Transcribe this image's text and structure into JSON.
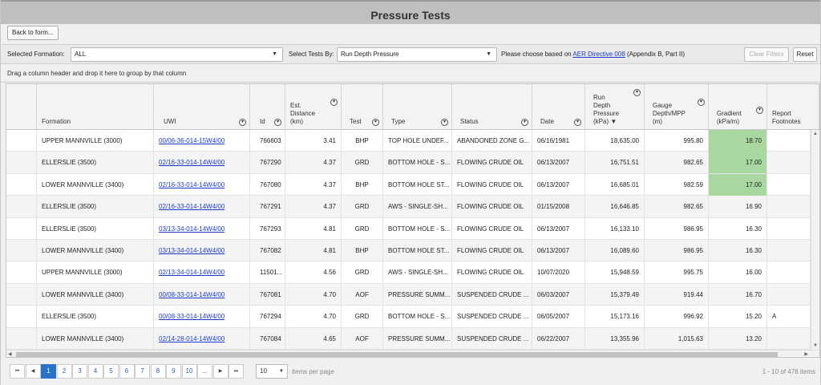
{
  "window": {
    "title": "Pressure Tests"
  },
  "back_button": "Back to form...",
  "toolbar": {
    "formation_label": "Selected Formation:",
    "formation_value": "ALL",
    "tests_label": "Select Tests By:",
    "tests_value": "Run Depth Pressure",
    "hint_prefix": "Please choose based on ",
    "hint_link": "AER Directive 008",
    "hint_suffix": " (Appendix B, Part II)",
    "clear_filters": "Clear Filters",
    "reset": "Reset"
  },
  "group_hint": "Drag a column header and drop it here to group by that column",
  "columns": {
    "formation": "Formation",
    "uwi": "UWI",
    "id": "Id",
    "dist": "Est.\nDistance\n(km)",
    "test": "Test",
    "type": "Type",
    "status": "Status",
    "date": "Date",
    "rdp": "Run\nDepth\nPressure\n(kPa) ▼",
    "gauge": "Gauge\nDepth/MPP\n(m)",
    "gradient": "Gradient\n(kPa/m)",
    "footnotes": "Report\nFootnotes"
  },
  "rows": [
    {
      "formation": "UPPER MANNVILLE (3000)",
      "uwi": "00/06-36-014-15W4/00",
      "id": "766603",
      "dist": "3.41",
      "test": "BHP",
      "type": "TOP HOLE UNDEF...",
      "status": "ABANDONED ZONE G...",
      "date": "06/16/1981",
      "rdp": "18,635.00",
      "gauge": "995.80",
      "gradient": "18.70",
      "footnote": "",
      "hl": true
    },
    {
      "formation": "ELLERSLIE (3500)",
      "uwi": "02/16-33-014-14W4/00",
      "id": "767290",
      "dist": "4.37",
      "test": "GRD",
      "type": "BOTTOM HOLE - S...",
      "status": "FLOWING CRUDE OIL",
      "date": "06/13/2007",
      "rdp": "16,751.51",
      "gauge": "982.65",
      "gradient": "17.00",
      "footnote": "",
      "hl": true
    },
    {
      "formation": "LOWER MANNVILLE (3400)",
      "uwi": "02/16-33-014-14W4/00",
      "id": "767080",
      "dist": "4.37",
      "test": "BHP",
      "type": "BOTTOM HOLE ST...",
      "status": "FLOWING CRUDE OIL",
      "date": "06/13/2007",
      "rdp": "16,685.01",
      "gauge": "982.59",
      "gradient": "17.00",
      "footnote": "",
      "hl": true
    },
    {
      "formation": "ELLERSLIE (3500)",
      "uwi": "02/16-33-014-14W4/00",
      "id": "767291",
      "dist": "4.37",
      "test": "GRD",
      "type": "AWS - SINGLE-SH...",
      "status": "FLOWING CRUDE OIL",
      "date": "01/15/2008",
      "rdp": "16,646.85",
      "gauge": "982.65",
      "gradient": "16.90",
      "footnote": "",
      "hl": false
    },
    {
      "formation": "ELLERSLIE (3500)",
      "uwi": "03/13-34-014-14W4/00",
      "id": "767293",
      "dist": "4.81",
      "test": "GRD",
      "type": "BOTTOM HOLE - S...",
      "status": "FLOWING CRUDE OIL",
      "date": "06/13/2007",
      "rdp": "16,133.10",
      "gauge": "986.95",
      "gradient": "16.30",
      "footnote": "",
      "hl": false
    },
    {
      "formation": "LOWER MANNVILLE (3400)",
      "uwi": "03/13-34-014-14W4/00",
      "id": "767082",
      "dist": "4.81",
      "test": "BHP",
      "type": "BOTTOM HOLE ST...",
      "status": "FLOWING CRUDE OIL",
      "date": "06/13/2007",
      "rdp": "16,089.60",
      "gauge": "986.95",
      "gradient": "16.30",
      "footnote": "",
      "hl": false
    },
    {
      "formation": "UPPER MANNVILLE (3000)",
      "uwi": "02/13-34-014-14W4/00",
      "id": "11501...",
      "dist": "4.56",
      "test": "GRD",
      "type": "AWS - SINGLE-SH...",
      "status": "FLOWING CRUDE OIL",
      "date": "10/07/2020",
      "rdp": "15,948.59",
      "gauge": "995.75",
      "gradient": "16.00",
      "footnote": "",
      "hl": false
    },
    {
      "formation": "LOWER MANNVILLE (3400)",
      "uwi": "00/08-33-014-14W4/00",
      "id": "767081",
      "dist": "4.70",
      "test": "AOF",
      "type": "PRESSURE SUMM...",
      "status": "SUSPENDED CRUDE ...",
      "date": "06/03/2007",
      "rdp": "15,379.49",
      "gauge": "919.44",
      "gradient": "16.70",
      "footnote": "",
      "hl": false
    },
    {
      "formation": "ELLERSLIE (3500)",
      "uwi": "00/08-33-014-14W4/00",
      "id": "767294",
      "dist": "4.70",
      "test": "GRD",
      "type": "BOTTOM HOLE - S...",
      "status": "SUSPENDED CRUDE ...",
      "date": "06/05/2007",
      "rdp": "15,173.16",
      "gauge": "996.92",
      "gradient": "15.20",
      "footnote": "A",
      "hl": false
    },
    {
      "formation": "LOWER MANNVILLE (3400)",
      "uwi": "02/14-28-014-14W4/00",
      "id": "767084",
      "dist": "4.65",
      "test": "AOF",
      "type": "PRESSURE SUMM...",
      "status": "SUSPENDED CRUDE ...",
      "date": "06/22/2007",
      "rdp": "13,355.96",
      "gauge": "1,015.63",
      "gradient": "13.20",
      "footnote": "",
      "hl": false
    }
  ],
  "pager": {
    "first": "⏮",
    "prev": "◀",
    "next": "▶",
    "last": "⏭",
    "pages": [
      "1",
      "2",
      "3",
      "4",
      "5",
      "6",
      "7",
      "8",
      "9",
      "10",
      "..."
    ],
    "active_page": "1",
    "page_size": "10",
    "items_label": "items per page",
    "summary": "1 - 10 of 478 items"
  },
  "colors": {
    "highlight": "#a8d8a0",
    "active_page": "#2a72c9",
    "link": "#1a3cc8"
  }
}
